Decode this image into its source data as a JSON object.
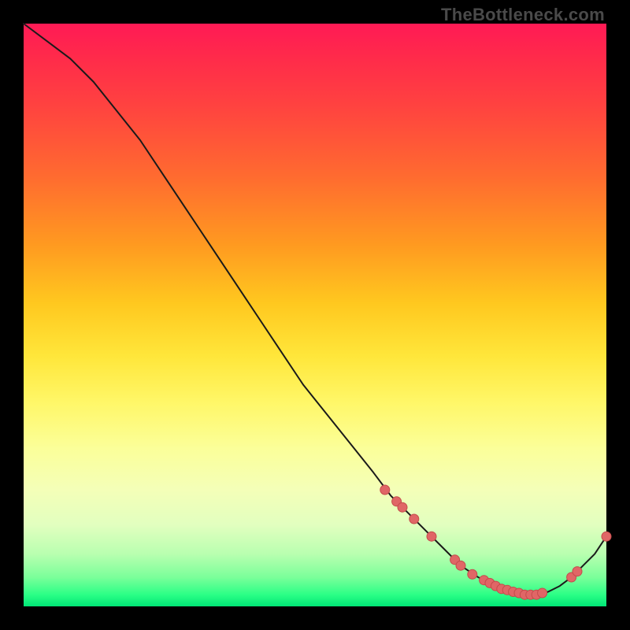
{
  "watermark": "TheBottleneck.com",
  "colors": {
    "curve_stroke": "#1a1a1a",
    "marker_fill": "#e06666",
    "marker_stroke": "#c44b4b"
  },
  "chart_data": {
    "type": "line",
    "title": "",
    "xlabel": "",
    "ylabel": "",
    "xlim": [
      0,
      100
    ],
    "ylim": [
      0,
      100
    ],
    "grid": false,
    "legend": false,
    "notes": "Bottleneck-style curve. Black line descends from top-left, flattens near bottom around x≈78-88, then rises slightly at the far right. Salmon-colored markers highlight the valley region plus one outlier at the right edge.",
    "series": [
      {
        "name": "curve",
        "x": [
          0,
          4,
          8,
          12,
          16,
          20,
          24,
          28,
          32,
          36,
          40,
          44,
          48,
          52,
          56,
          60,
          63,
          66,
          69,
          72,
          75,
          78,
          80,
          82,
          84,
          86,
          88,
          90,
          92,
          94,
          96,
          98,
          100
        ],
        "y": [
          100,
          97,
          94,
          90,
          85,
          80,
          74,
          68,
          62,
          56,
          50,
          44,
          38,
          33,
          28,
          23,
          19,
          16,
          13,
          10,
          7,
          5,
          4,
          3,
          2.5,
          2,
          2,
          2.5,
          3.5,
          5,
          7,
          9,
          12
        ]
      }
    ],
    "markers": [
      {
        "x": 62,
        "y": 20
      },
      {
        "x": 64,
        "y": 18
      },
      {
        "x": 65,
        "y": 17
      },
      {
        "x": 67,
        "y": 15
      },
      {
        "x": 70,
        "y": 12
      },
      {
        "x": 74,
        "y": 8
      },
      {
        "x": 75,
        "y": 7
      },
      {
        "x": 77,
        "y": 5.5
      },
      {
        "x": 79,
        "y": 4.5
      },
      {
        "x": 80,
        "y": 4
      },
      {
        "x": 81,
        "y": 3.5
      },
      {
        "x": 82,
        "y": 3
      },
      {
        "x": 83,
        "y": 2.8
      },
      {
        "x": 84,
        "y": 2.5
      },
      {
        "x": 85,
        "y": 2.3
      },
      {
        "x": 86,
        "y": 2
      },
      {
        "x": 87,
        "y": 2
      },
      {
        "x": 88,
        "y": 2
      },
      {
        "x": 89,
        "y": 2.3
      },
      {
        "x": 94,
        "y": 5
      },
      {
        "x": 95,
        "y": 6
      },
      {
        "x": 100,
        "y": 12
      }
    ]
  }
}
